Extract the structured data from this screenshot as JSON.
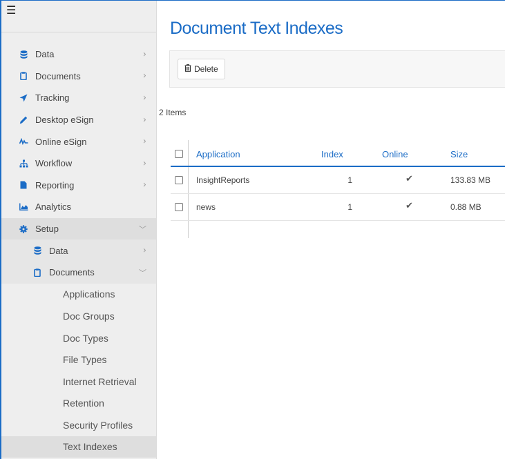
{
  "sidebar": {
    "menu_icon": "hamburger-icon",
    "items": [
      {
        "label": "Data",
        "icon": "database-icon",
        "chevron": "right"
      },
      {
        "label": "Documents",
        "icon": "clipboard-icon",
        "chevron": "right"
      },
      {
        "label": "Tracking",
        "icon": "send-icon",
        "chevron": "right"
      },
      {
        "label": "Desktop eSign",
        "icon": "pen-icon",
        "chevron": "right"
      },
      {
        "label": "Online eSign",
        "icon": "signature-icon",
        "chevron": "right"
      },
      {
        "label": "Workflow",
        "icon": "sitemap-icon",
        "chevron": "right"
      },
      {
        "label": "Reporting",
        "icon": "file-icon",
        "chevron": "right"
      },
      {
        "label": "Analytics",
        "icon": "area-chart-icon",
        "chevron": ""
      },
      {
        "label": "Setup",
        "icon": "gear-icon",
        "chevron": "down"
      }
    ],
    "setup_items": [
      {
        "label": "Data",
        "icon": "database-icon",
        "chevron": "right"
      },
      {
        "label": "Documents",
        "icon": "clipboard-icon",
        "chevron": "down"
      }
    ],
    "documents_items": [
      {
        "label": "Applications"
      },
      {
        "label": "Doc Groups"
      },
      {
        "label": "Doc Types"
      },
      {
        "label": "File Types"
      },
      {
        "label": "Internet Retrieval"
      },
      {
        "label": "Retention"
      },
      {
        "label": "Security Profiles"
      },
      {
        "label": "Text Indexes"
      }
    ]
  },
  "main": {
    "title": "Document Text Indexes",
    "toolbar": {
      "delete_label": "Delete",
      "delete_icon": "trash-icon"
    },
    "item_count": "2 Items",
    "table": {
      "headers": {
        "application": "Application",
        "index": "Index",
        "online": "Online",
        "size": "Size"
      },
      "rows": [
        {
          "application": "InsightReports",
          "index": "1",
          "online": "✔",
          "size": "133.83 MB"
        },
        {
          "application": "news",
          "index": "1",
          "online": "✔",
          "size": "0.88 MB"
        }
      ]
    }
  },
  "colors": {
    "accent": "#1b6cc6",
    "sidebar_bg": "#eeeeee"
  }
}
